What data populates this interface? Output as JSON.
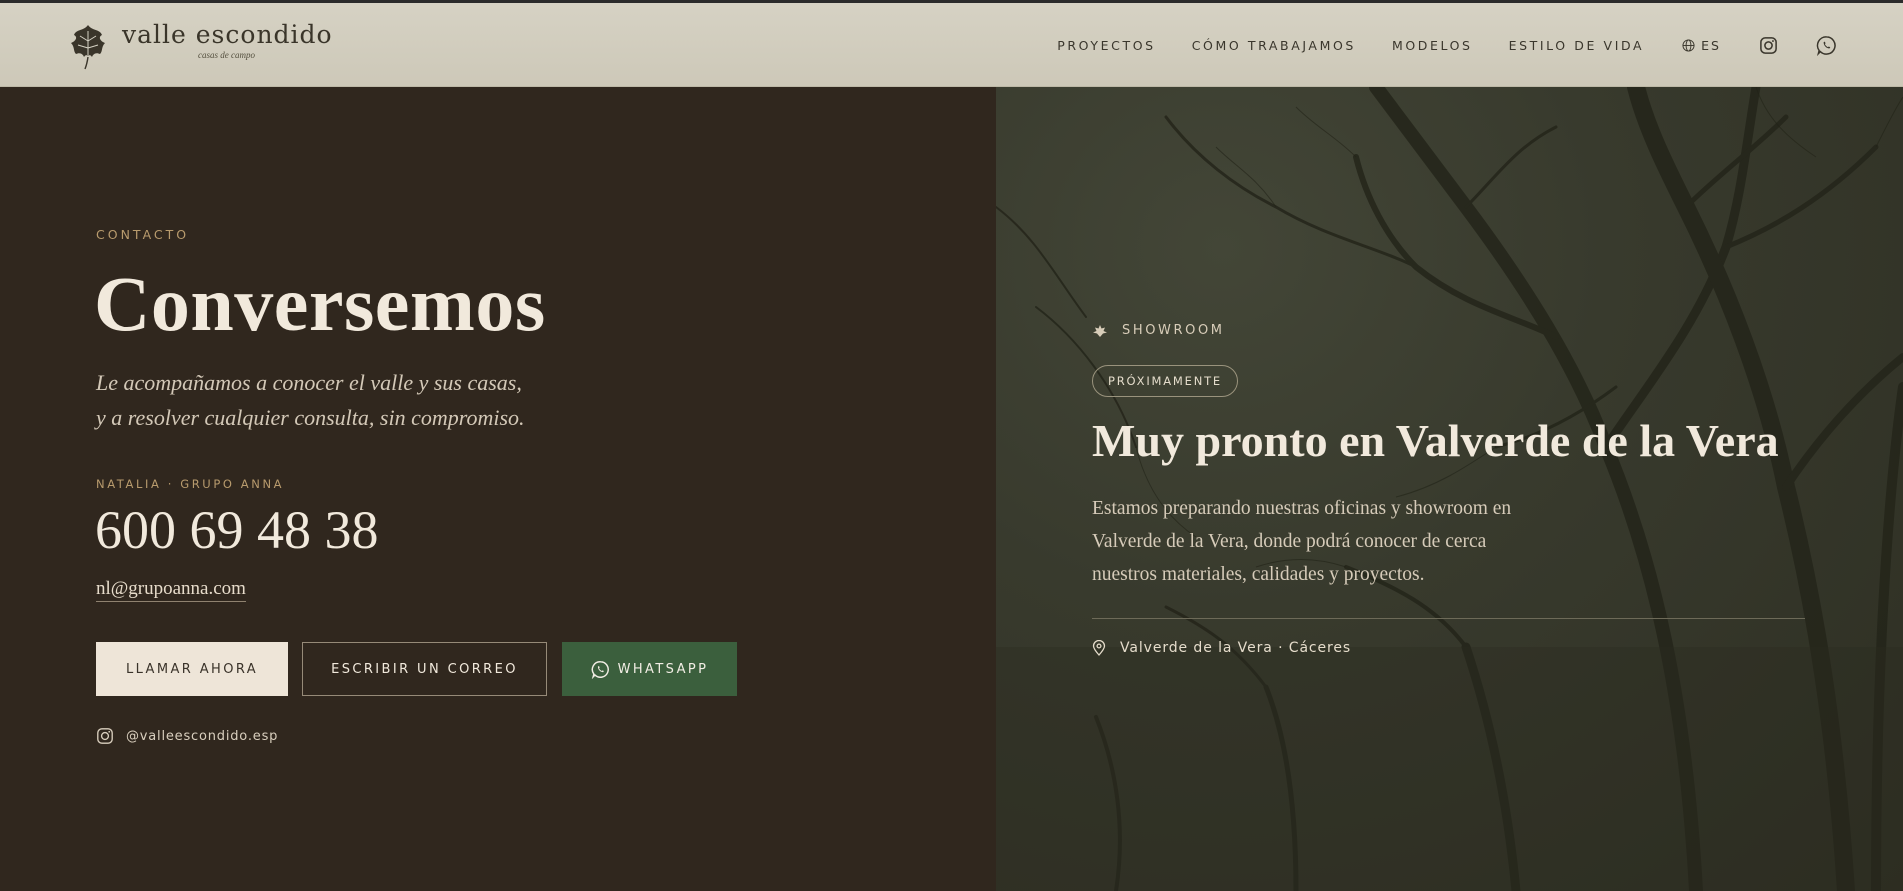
{
  "header": {
    "logo_name": "valle escondido",
    "logo_tagline": "casas de campo",
    "nav": [
      {
        "label": "PROYECTOS"
      },
      {
        "label": "CÓMO TRABAJAMOS"
      },
      {
        "label": "MODELOS"
      },
      {
        "label": "ESTILO DE VIDA"
      }
    ],
    "language": "ES",
    "icons": [
      "globe-icon",
      "instagram-icon",
      "whatsapp-icon"
    ]
  },
  "contact": {
    "eyebrow": "CONTACTO",
    "title": "Conversemos",
    "subtitle": "Le acompañamos a conocer el valle y sus casas, y a resolver cualquier consulta, sin compromiso.",
    "person_label": "NATALIA · GRUPO ANNA",
    "phone": "600 69 48 38",
    "email": "nl@grupoanna.com",
    "buttons": {
      "call": "LLAMAR AHORA",
      "mail": "ESCRIBIR UN CORREO",
      "whatsapp": "WHATSAPP"
    },
    "instagram": "@valleescondido.esp"
  },
  "showroom": {
    "eyebrow": "SHOWROOM",
    "badge": "PRÓXIMAMENTE",
    "title": "Muy pronto en Valverde de la Vera",
    "description": "Estamos preparando nuestras oficinas y showroom en Valverde de la Vera, donde podrá conocer de cerca nuestros materiales, calidades y proyectos.",
    "location": "Valverde de la Vera · Cáceres"
  },
  "colors": {
    "dark_brown": "#30271e",
    "header_bg": "#d6d2c4",
    "accent_gold": "#b89b6d",
    "cream": "#f1e9dc",
    "whatsapp_green": "#3b5f3d",
    "forest": "#383a2d"
  }
}
